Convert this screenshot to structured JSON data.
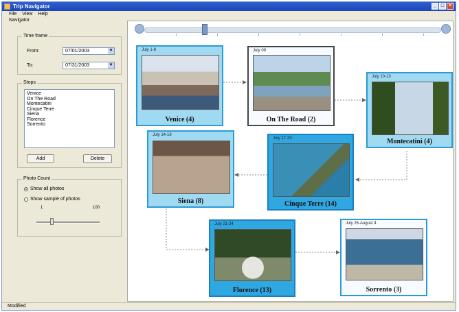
{
  "window": {
    "title": "Trip Navigator"
  },
  "menu": [
    "File",
    "View",
    "Help"
  ],
  "panel_label": "Navigator",
  "timeframe": {
    "legend": "Time frame",
    "from_label": "From:",
    "from_value": "07/01/2003",
    "to_label": "To:",
    "to_value": "07/31/2003"
  },
  "stops": {
    "legend": "Stops",
    "items": [
      "Venice",
      "On The Road",
      "Montecatini",
      "Cinque Terre",
      "Siena",
      "Florence",
      "Sorrento"
    ],
    "add_label": "Add",
    "delete_label": "Delete"
  },
  "photo_count": {
    "legend": "Photo Count",
    "option1": "Show all photos",
    "option2": "Show sample of photos",
    "selected": 1,
    "scale_min": "1",
    "scale_max": "100"
  },
  "status": "Modified",
  "cards": [
    {
      "date": "July 1-8",
      "name": "Venice (4)",
      "style": "light"
    },
    {
      "date": "July 09",
      "name": "On The Road (2)",
      "style": "white"
    },
    {
      "date": "July 10-13",
      "name": "Montecatini (4)",
      "style": "light"
    },
    {
      "date": "July 14-16",
      "name": "Siena (8)",
      "style": "light"
    },
    {
      "date": "July 17-20",
      "name": "Cinque Terre (14)",
      "style": "deep"
    },
    {
      "date": "July 21-24",
      "name": "Florence (13)",
      "style": "deep"
    },
    {
      "date": "July 25-August 4",
      "name": "Sorrento (3)",
      "style": "white"
    }
  ],
  "colors": {
    "title_bar": "#1c46b8",
    "card_light": "#9fd9f2",
    "card_deep": "#2fa7e0",
    "card_border": "#2a9bd4"
  }
}
